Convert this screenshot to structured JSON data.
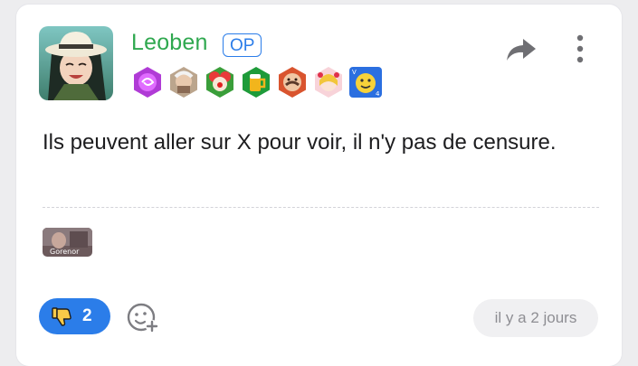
{
  "post": {
    "username": "Leoben",
    "op_badge": "OP",
    "message": "Ils peuvent aller sur X pour voir, il n'y pas de censure.",
    "signature_text": "Gorenor",
    "timestamp": "il y a 2 jours"
  },
  "reactions": {
    "thumbs_down_count": "2"
  },
  "icons": {
    "share": "share-arrow-icon",
    "more": "vertical-dots-icon",
    "vote": "thumbs-down-icon",
    "add_reaction": "add-emoji-icon"
  },
  "colors": {
    "username": "#2fa84f",
    "accent": "#2b7de9",
    "text": "#1d1d1f",
    "timestamp_bg": "#f0f0f2"
  }
}
